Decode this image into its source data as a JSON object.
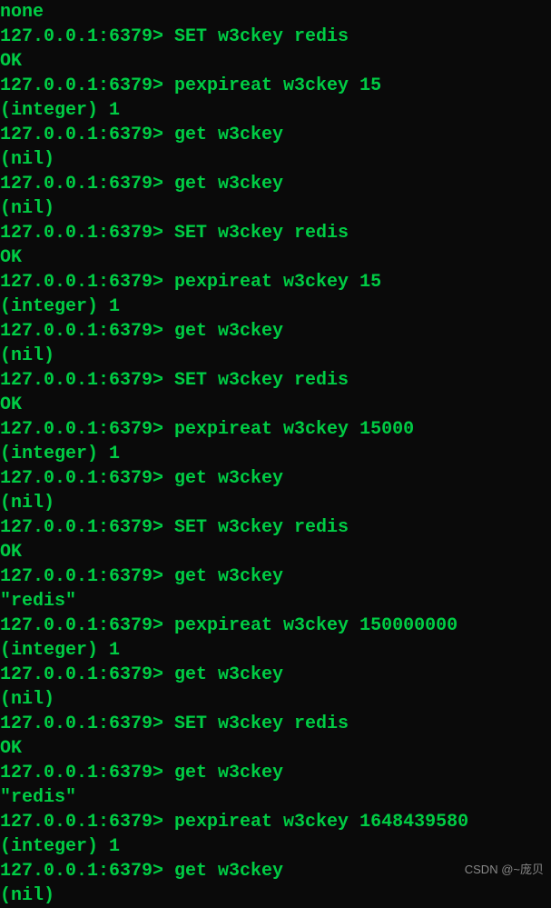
{
  "terminal": {
    "prompt": "127.0.0.1:6379>",
    "lines": [
      "none",
      "127.0.0.1:6379> SET w3ckey redis",
      "OK",
      "127.0.0.1:6379> pexpireat w3ckey 15",
      "(integer) 1",
      "127.0.0.1:6379> get w3ckey",
      "(nil)",
      "127.0.0.1:6379> get w3ckey",
      "(nil)",
      "127.0.0.1:6379> SET w3ckey redis",
      "OK",
      "127.0.0.1:6379> pexpireat w3ckey 15",
      "(integer) 1",
      "127.0.0.1:6379> get w3ckey",
      "(nil)",
      "127.0.0.1:6379> SET w3ckey redis",
      "OK",
      "127.0.0.1:6379> pexpireat w3ckey 15000",
      "(integer) 1",
      "127.0.0.1:6379> get w3ckey",
      "(nil)",
      "127.0.0.1:6379> SET w3ckey redis",
      "OK",
      "127.0.0.1:6379> get w3ckey",
      "\"redis\"",
      "127.0.0.1:6379> pexpireat w3ckey 150000000",
      "(integer) 1",
      "127.0.0.1:6379> get w3ckey",
      "(nil)",
      "127.0.0.1:6379> SET w3ckey redis",
      "OK",
      "127.0.0.1:6379> get w3ckey",
      "\"redis\"",
      "127.0.0.1:6379> pexpireat w3ckey 1648439580",
      "(integer) 1",
      "127.0.0.1:6379> get w3ckey",
      "(nil)"
    ]
  },
  "watermark": "CSDN @~庞贝"
}
